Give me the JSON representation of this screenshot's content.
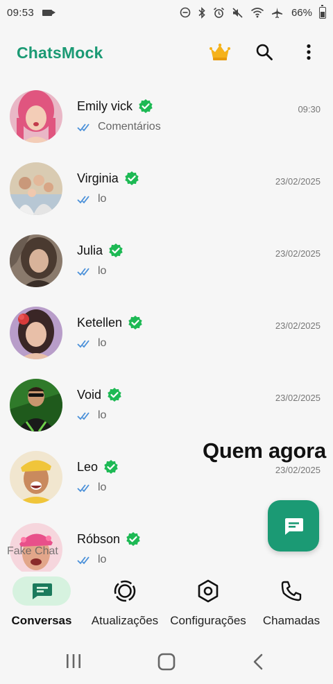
{
  "status_bar": {
    "time": "09:53",
    "battery": "66%",
    "battery_level": 0.66,
    "icons": [
      "video-record-icon",
      "dnd-icon",
      "bluetooth-icon",
      "alarm-icon",
      "mute-icon",
      "wifi-icon",
      "airplane-icon",
      "battery-icon"
    ]
  },
  "app_bar": {
    "title": "ChatsMock",
    "icons": [
      "crown-icon",
      "search-icon",
      "more-vert-icon"
    ]
  },
  "chats": [
    {
      "name": "Emily  vick",
      "last_message": "Comentários",
      "time": "09:30",
      "verified": true
    },
    {
      "name": "Virginia",
      "last_message": "lo",
      "time": "23/02/2025",
      "verified": true
    },
    {
      "name": "Julia",
      "last_message": "lo",
      "time": "23/02/2025",
      "verified": true
    },
    {
      "name": "Ketellen",
      "last_message": "lo",
      "time": "23/02/2025",
      "verified": true
    },
    {
      "name": "Void",
      "last_message": "lo",
      "time": "23/02/2025",
      "verified": true
    },
    {
      "name": "Leo",
      "last_message": "lo",
      "time": "23/02/2025",
      "verified": true
    },
    {
      "name": "Róbson",
      "last_message": "lo",
      "time": "",
      "verified": true
    }
  ],
  "overlay_text": "Quem agora",
  "watermark": "Fake Chat",
  "bottom_nav": [
    {
      "label": "Conversas",
      "icon": "chat-icon",
      "active": true
    },
    {
      "label": "Atualizações",
      "icon": "updates-icon",
      "active": false
    },
    {
      "label": "Configurações",
      "icon": "settings-icon",
      "active": false
    },
    {
      "label": "Chamadas",
      "icon": "phone-icon",
      "active": false
    }
  ],
  "colors": {
    "brand": "#1b9a74",
    "active_pill": "#d6f2df",
    "read_ticks": "#4a90d9",
    "crown": "#f5b21b"
  }
}
